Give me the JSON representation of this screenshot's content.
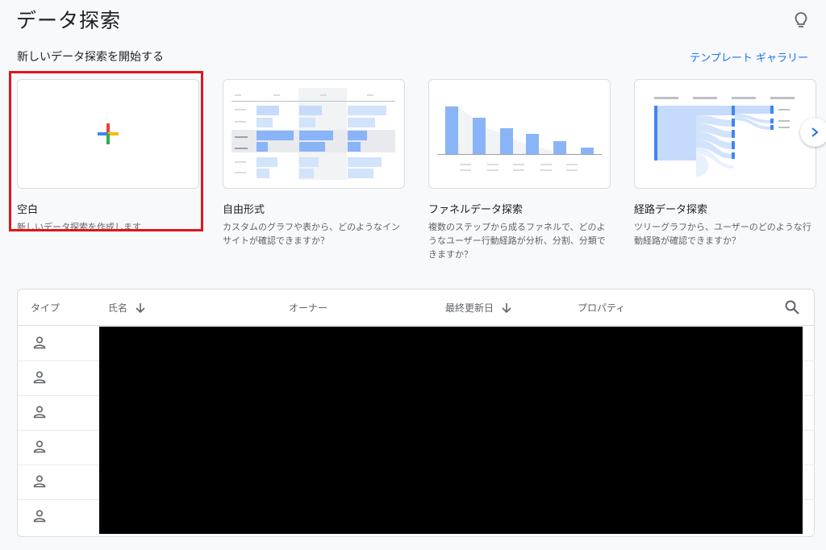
{
  "header": {
    "title": "データ探索",
    "subtitle": "新しいデータ探索を開始する",
    "gallery_link": "テンプレート ギャラリー"
  },
  "cards": [
    {
      "title": "空白",
      "desc": "新しいデータ探索を作成します"
    },
    {
      "title": "自由形式",
      "desc": "カスタムのグラフや表から、どのようなインサイトが確認できますか？"
    },
    {
      "title": "ファネルデータ探索",
      "desc": "複数のステップから成るファネルで、どのようなユーザー行動経路が分析、分割、分類できますか？"
    },
    {
      "title": "経路データ探索",
      "desc": "ツリーグラフから、ユーザーのどのような行動経路が確認できますか？"
    }
  ],
  "table": {
    "columns": {
      "type": "タイプ",
      "name": "氏名",
      "owner": "オーナー",
      "updated": "最終更新日",
      "property": "プロパティ"
    },
    "row_icon": "person-icon",
    "row_count": 6
  },
  "colors": {
    "accent": "#1a73e8",
    "selection": "#e0161b",
    "bar_blue": "#8ab4f8"
  }
}
